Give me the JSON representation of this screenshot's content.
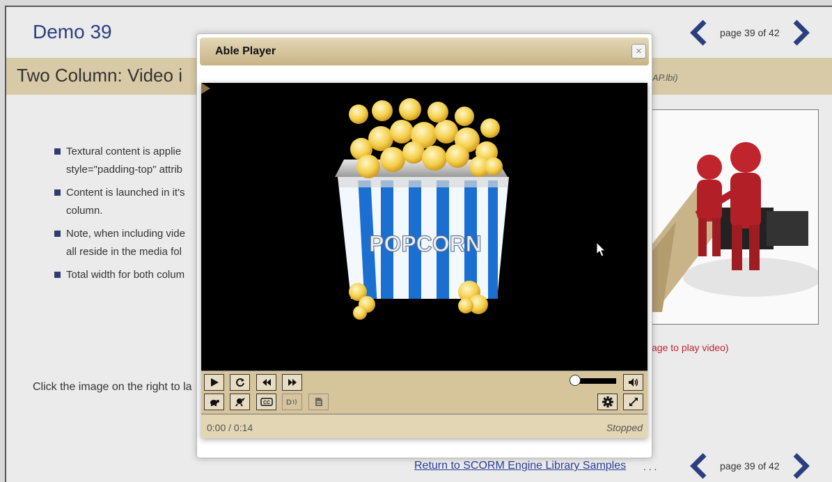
{
  "page": {
    "title": "Demo 39",
    "subtitle": "Two Column: Video i",
    "subtitle_note": "AP.lbi)",
    "pager_text": "page 39 of 42",
    "bullets": [
      {
        "line1": "Textural content is applie",
        "line2": "style=\"padding-top\" attrib"
      },
      {
        "line1": "Content is launched in it's",
        "line2": "column."
      },
      {
        "line1": "Note, when including vide",
        "line2": "all reside in the media fol"
      },
      {
        "line1": "Total width for both colum",
        "line2": ""
      }
    ],
    "click_text": "Click the image on the right to la",
    "figure_caption": "age to play video)",
    "footer_link": "Return to SCORM Engine Library Samples",
    "footer_dots": ". . ."
  },
  "modal": {
    "title": "Able Player",
    "close_glyph": "×"
  },
  "player": {
    "popcorn_label": "POPCORN",
    "time": "0:00 / 0:14",
    "status": "Stopped",
    "volume": 0
  },
  "colors": {
    "title_blue": "#2b3f80",
    "header_tan": "#d8caa6",
    "player_controls": "#d6c49b",
    "caption_red": "#c0242c"
  },
  "icons": [
    "chevron-left-icon",
    "chevron-right-icon",
    "play-icon",
    "restart-icon",
    "rewind-icon",
    "forward-icon",
    "volume-icon",
    "slower-icon",
    "faster-icon",
    "captions-icon",
    "audio-description-icon",
    "transcript-icon",
    "settings-icon",
    "fullscreen-icon",
    "close-icon",
    "mouse-cursor-icon"
  ]
}
